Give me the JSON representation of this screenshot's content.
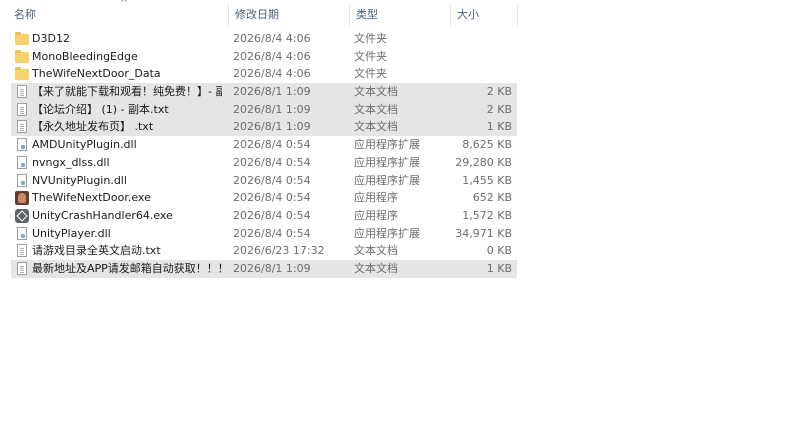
{
  "columns": {
    "name": "名称",
    "date": "修改日期",
    "type": "类型",
    "size": "大小"
  },
  "files": [
    {
      "name": "D3D12",
      "date": "2026/8/4 4:06",
      "type": "文件夹",
      "size": "",
      "icon": "folder-icon",
      "selected": false
    },
    {
      "name": "MonoBleedingEdge",
      "date": "2026/8/4 4:06",
      "type": "文件夹",
      "size": "",
      "icon": "folder-icon",
      "selected": false
    },
    {
      "name": "TheWifeNextDoor_Data",
      "date": "2026/8/4 4:06",
      "type": "文件夹",
      "size": "",
      "icon": "folder-icon",
      "selected": false
    },
    {
      "name": "【来了就能下载和观看！纯免费！】- 副...",
      "date": "2026/8/1 1:09",
      "type": "文本文档",
      "size": "2 KB",
      "icon": "text-file-icon",
      "selected": true
    },
    {
      "name": "【论坛介绍】 (1) - 副本.txt",
      "date": "2026/8/1 1:09",
      "type": "文本文档",
      "size": "2 KB",
      "icon": "text-file-icon",
      "selected": true
    },
    {
      "name": "【永久地址发布页】 .txt",
      "date": "2026/8/1 1:09",
      "type": "文本文档",
      "size": "1 KB",
      "icon": "text-file-icon",
      "selected": true
    },
    {
      "name": "AMDUnityPlugin.dll",
      "date": "2026/8/4 0:54",
      "type": "应用程序扩展",
      "size": "8,625 KB",
      "icon": "dll-file-icon",
      "selected": false
    },
    {
      "name": "nvngx_dlss.dll",
      "date": "2026/8/4 0:54",
      "type": "应用程序扩展",
      "size": "29,280 KB",
      "icon": "dll-file-icon",
      "selected": false
    },
    {
      "name": "NVUnityPlugin.dll",
      "date": "2026/8/4 0:54",
      "type": "应用程序扩展",
      "size": "1,455 KB",
      "icon": "dll-file-icon",
      "selected": false
    },
    {
      "name": "TheWifeNextDoor.exe",
      "date": "2026/8/4 0:54",
      "type": "应用程序",
      "size": "652 KB",
      "icon": "app-icon",
      "selected": false
    },
    {
      "name": "UnityCrashHandler64.exe",
      "date": "2026/8/4 0:54",
      "type": "应用程序",
      "size": "1,572 KB",
      "icon": "unity-icon",
      "selected": false
    },
    {
      "name": "UnityPlayer.dll",
      "date": "2026/8/4 0:54",
      "type": "应用程序扩展",
      "size": "34,971 KB",
      "icon": "dll-file-icon",
      "selected": false
    },
    {
      "name": "请游戏目录全英文启动.txt",
      "date": "2026/6/23 17:32",
      "type": "文本文档",
      "size": "0 KB",
      "icon": "text-file-icon",
      "selected": false
    },
    {
      "name": "最新地址及APP请发邮箱自动获取！！！...",
      "date": "2026/8/1 1:09",
      "type": "文本文档",
      "size": "1 KB",
      "icon": "text-file-icon",
      "selected": true
    }
  ],
  "colors": {
    "selected_row_bg": "#e5e5e5",
    "header_text": "#4c607a",
    "folder": "#f8d26a"
  }
}
